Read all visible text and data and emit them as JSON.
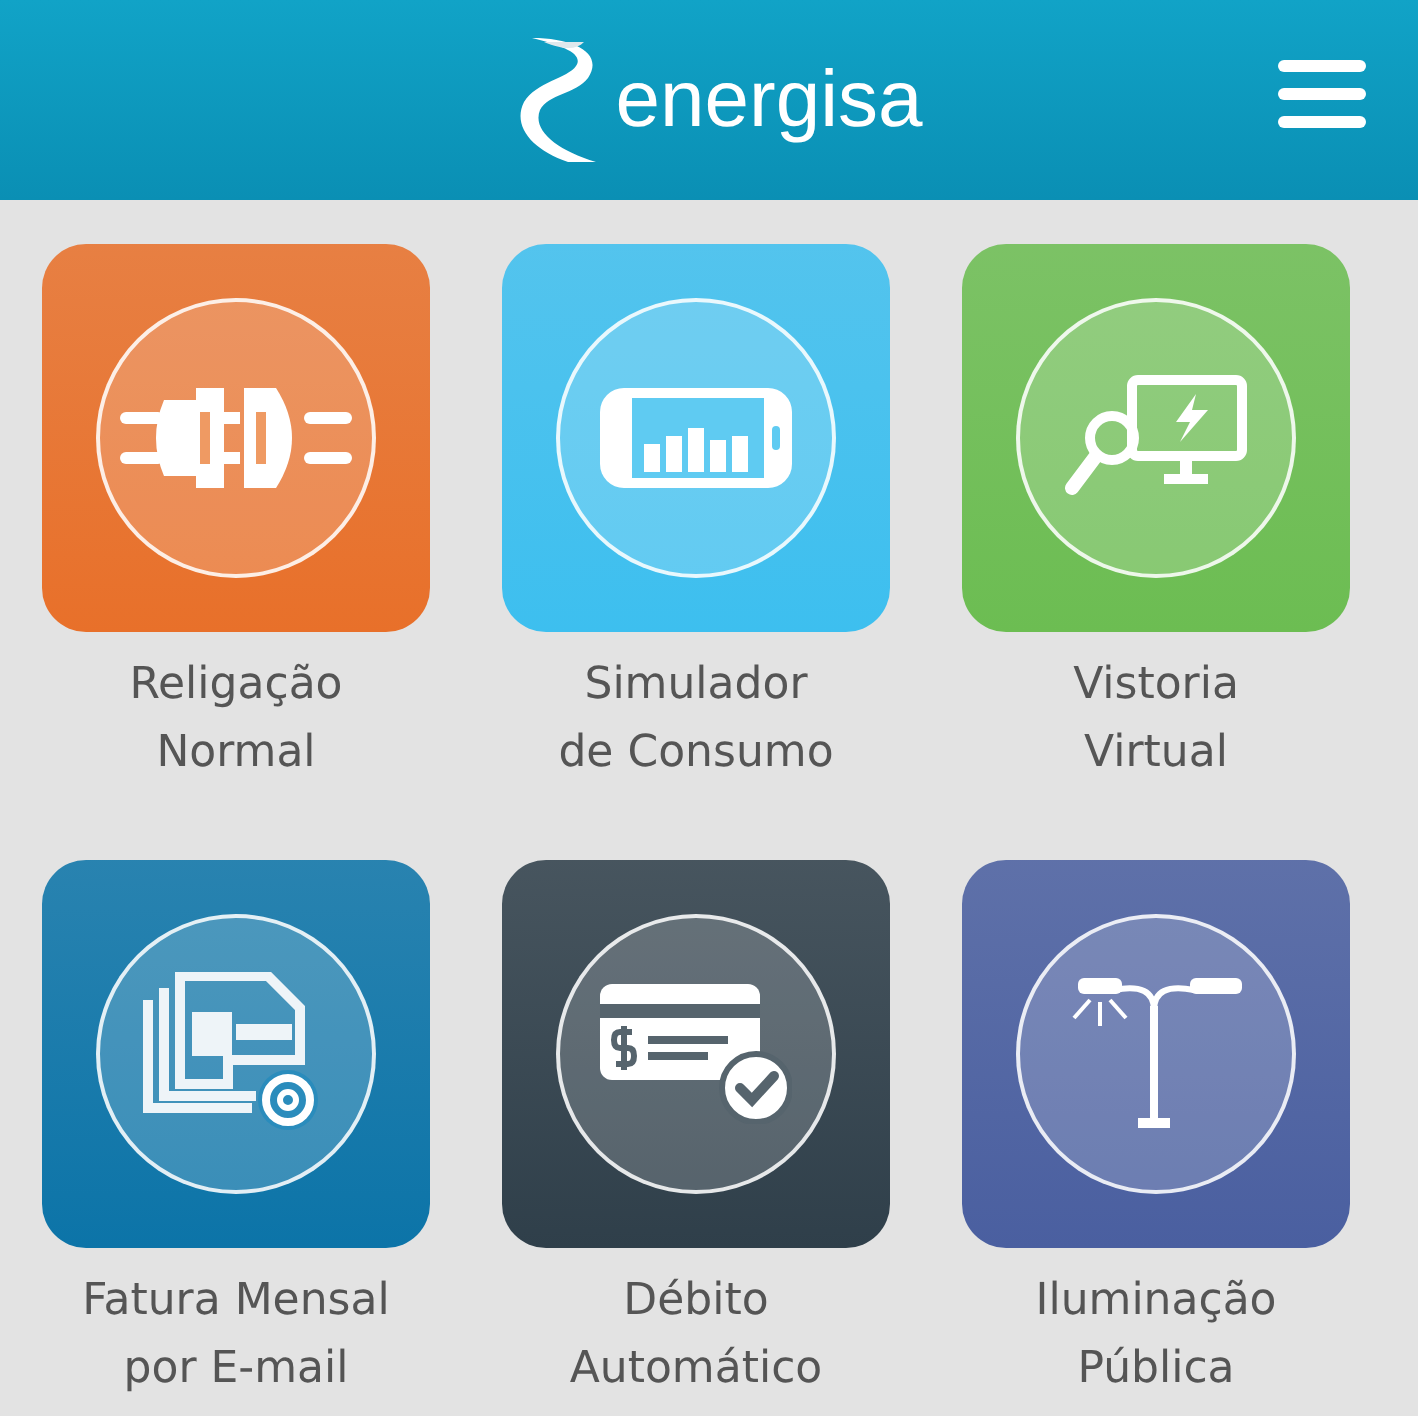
{
  "header": {
    "logo_text": "energisa"
  },
  "tiles": [
    {
      "kind": "plug",
      "color": "#e8702a",
      "label": [
        "Religação",
        "Normal"
      ]
    },
    {
      "kind": "phone-chart",
      "color": "#3dbfef",
      "label": [
        "Simulador",
        "de Consumo"
      ]
    },
    {
      "kind": "monitor-search",
      "color": "#6cbd52",
      "label": [
        "Vistoria",
        "Virtual"
      ]
    },
    {
      "kind": "invoice-email",
      "color": "#0c74a8",
      "label": [
        "Fatura Mensal",
        "por E-mail"
      ]
    },
    {
      "kind": "card-check",
      "color": "#2f3f4a",
      "label": [
        "Débito",
        "Automático"
      ]
    },
    {
      "kind": "streetlight",
      "color": "#4a5fa0",
      "label": [
        "Iluminação",
        "Pública"
      ]
    }
  ]
}
